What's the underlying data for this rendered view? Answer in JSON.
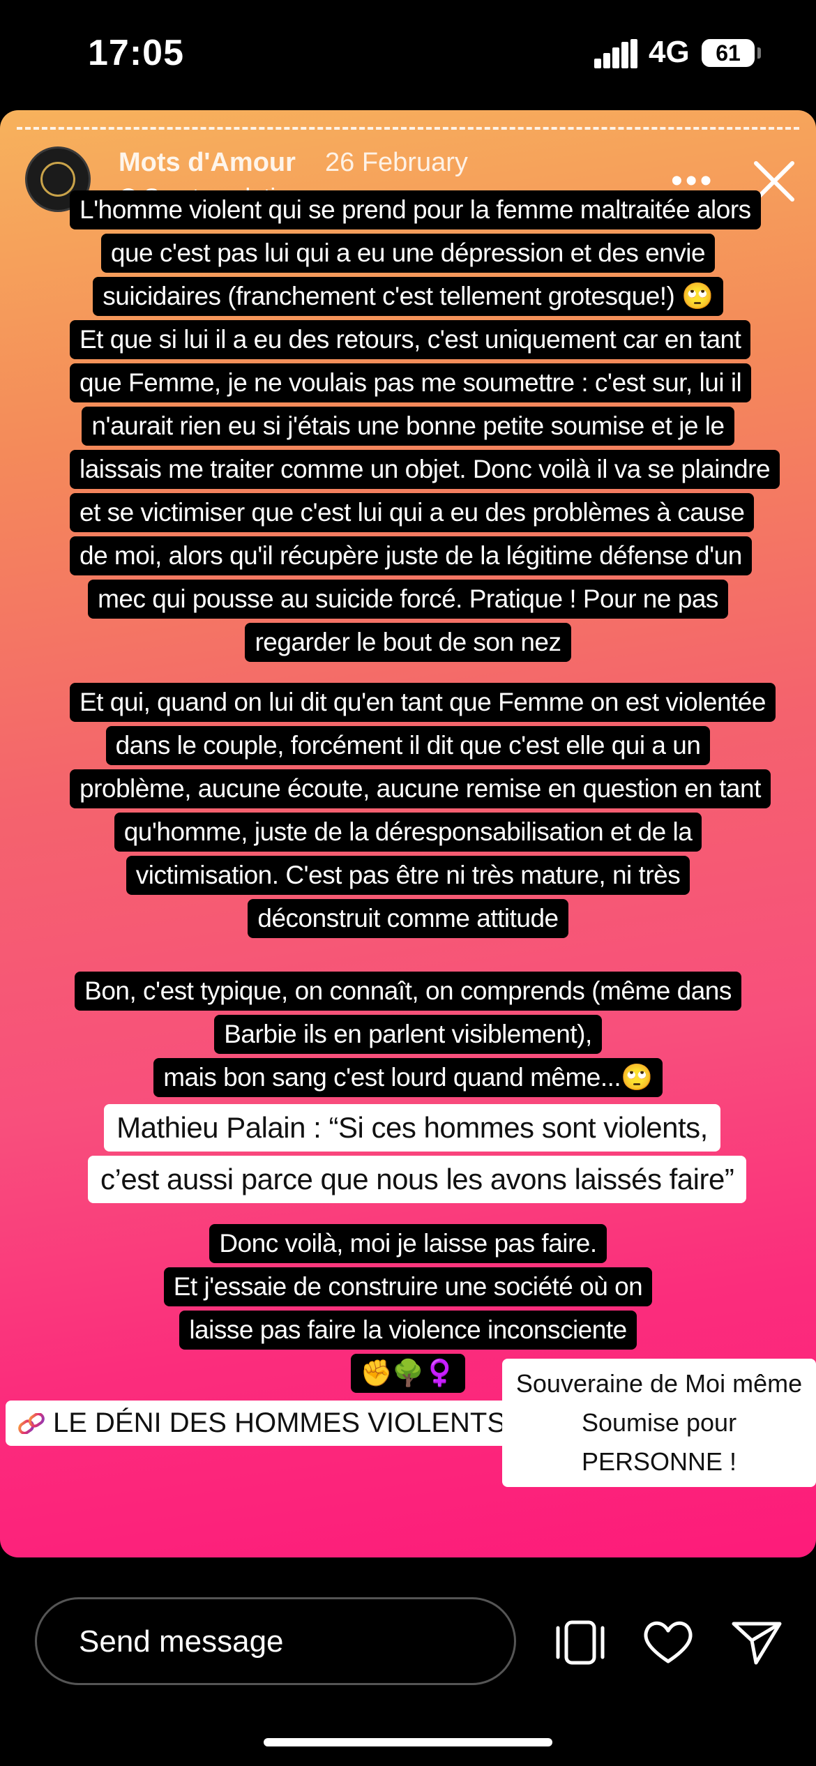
{
  "status": {
    "time": "17:05",
    "network": "4G",
    "battery": "61"
  },
  "story": {
    "username": "Mots d'Amour",
    "date": "26 February",
    "see_translation": "See translation",
    "paragraph1": [
      "L'homme violent qui se prend pour la femme maltraitée alors",
      "que c'est pas lui qui a eu une dépression et des envie",
      "suicidaires (franchement c'est tellement grotesque!) 🙄",
      "Et que si lui il a eu des retours, c'est uniquement car en tant",
      "que Femme, je ne voulais pas me soumettre : c'est sur, lui il",
      "n'aurait rien eu si j'étais une bonne petite soumise et je le",
      "laissais me traiter comme un objet. Donc voilà il va se plaindre",
      "et se victimiser que c'est lui qui a eu des problèmes à cause",
      "de moi, alors qu'il récupère juste de la légitime défense d'un",
      "mec qui pousse au suicide forcé. Pratique ! Pour ne pas",
      "regarder le bout de son nez"
    ],
    "paragraph2": [
      "Et qui, quand on lui dit qu'en tant que Femme on est violentée",
      "dans le couple, forcément il dit que c'est elle qui a un",
      "problème, aucune écoute, aucune remise en question en tant",
      "qu'homme, juste de la déresponsabilisation et de la",
      "victimisation. C'est pas être ni très mature, ni très",
      "déconstruit comme attitude"
    ],
    "paragraph3": [
      "Bon, c'est typique, on connaît, on comprends (même dans",
      "Barbie ils en parlent visiblement),",
      "mais bon sang c'est lourd quand même...🙄"
    ],
    "quote": [
      "Mathieu Palain : “Si ces hommes sont violents,",
      "c’est aussi parce que nous les avons laissés faire”"
    ],
    "paragraph4": [
      "Donc voilà, moi je laisse pas faire.",
      "Et j'essaie de construire une société où on",
      "laisse pas faire la violence inconsciente",
      "✊🌳♀️"
    ],
    "link_sticker": "LE DÉNI DES HOMMES VIOLENTS",
    "self_sticker": [
      "Souveraine de Moi même",
      "Soumise pour PERSONNE !"
    ]
  },
  "bottom": {
    "placeholder": "Send message"
  },
  "icons": [
    "signal-icon",
    "battery-icon",
    "close-icon",
    "more-icon",
    "link-icon",
    "gallery-icon",
    "heart-icon",
    "send-icon"
  ]
}
